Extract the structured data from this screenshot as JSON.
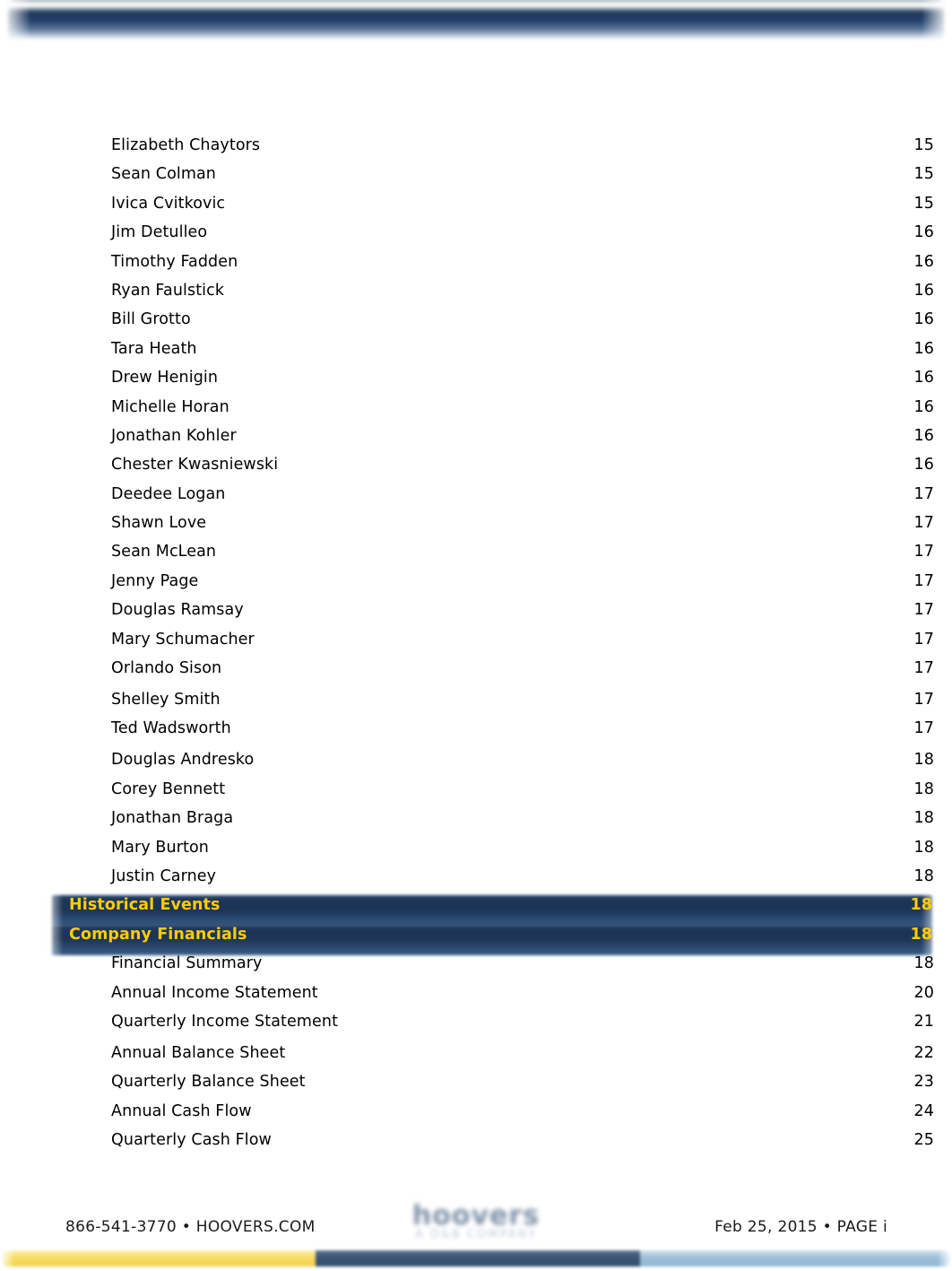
{
  "document": {
    "page_label": "i",
    "colors": {
      "navy": "#1d3557",
      "highlight_text": "#ffcc00",
      "body_text": "#000000",
      "bar_yellow": "#f6dc62",
      "bar_navy": "#32506e",
      "bar_lightblue": "#9dc0da"
    }
  },
  "toc": {
    "entries": [
      {
        "label": "Elizabeth Chaytors",
        "page": "15",
        "level": 2,
        "gap_before": false
      },
      {
        "label": "Sean Colman",
        "page": "15",
        "level": 2,
        "gap_before": false
      },
      {
        "label": "Ivica Cvitkovic",
        "page": "15",
        "level": 2,
        "gap_before": false
      },
      {
        "label": "Jim Detulleo",
        "page": "16",
        "level": 2,
        "gap_before": false
      },
      {
        "label": "Timothy Fadden",
        "page": "16",
        "level": 2,
        "gap_before": false
      },
      {
        "label": "Ryan Faulstick",
        "page": "16",
        "level": 2,
        "gap_before": false
      },
      {
        "label": "Bill Grotto",
        "page": "16",
        "level": 2,
        "gap_before": false
      },
      {
        "label": "Tara Heath",
        "page": "16",
        "level": 2,
        "gap_before": false
      },
      {
        "label": "Drew Henigin",
        "page": "16",
        "level": 2,
        "gap_before": false
      },
      {
        "label": "Michelle Horan",
        "page": "16",
        "level": 2,
        "gap_before": false
      },
      {
        "label": "Jonathan Kohler",
        "page": "16",
        "level": 2,
        "gap_before": false
      },
      {
        "label": "Chester Kwasniewski",
        "page": "16",
        "level": 2,
        "gap_before": false
      },
      {
        "label": "Deedee Logan",
        "page": "17",
        "level": 2,
        "gap_before": false
      },
      {
        "label": "Shawn Love",
        "page": "17",
        "level": 2,
        "gap_before": false
      },
      {
        "label": "Sean McLean",
        "page": "17",
        "level": 2,
        "gap_before": false
      },
      {
        "label": "Jenny Page",
        "page": "17",
        "level": 2,
        "gap_before": false
      },
      {
        "label": "Douglas Ramsay",
        "page": "17",
        "level": 2,
        "gap_before": false
      },
      {
        "label": "Mary Schumacher",
        "page": "17",
        "level": 2,
        "gap_before": false
      },
      {
        "label": "Orlando Sison",
        "page": "17",
        "level": 2,
        "gap_before": false
      },
      {
        "label": "Shelley Smith",
        "page": "17",
        "level": 2,
        "gap_before": true
      },
      {
        "label": "Ted Wadsworth",
        "page": "17",
        "level": 2,
        "gap_before": false
      },
      {
        "label": "Douglas Andresko",
        "page": "18",
        "level": 2,
        "gap_before": true
      },
      {
        "label": "Corey Bennett",
        "page": "18",
        "level": 2,
        "gap_before": false
      },
      {
        "label": "Jonathan Braga",
        "page": "18",
        "level": 2,
        "gap_before": false
      },
      {
        "label": "Mary Burton",
        "page": "18",
        "level": 2,
        "gap_before": false
      },
      {
        "label": "Justin Carney",
        "page": "18",
        "level": 2,
        "gap_before": false
      },
      {
        "label": "Historical Events",
        "page": "18",
        "level": 1,
        "gap_before": false
      },
      {
        "label": "Company Financials",
        "page": "18",
        "level": 1,
        "gap_before": false
      },
      {
        "label": "Financial Summary",
        "page": "18",
        "level": 2,
        "gap_before": false
      },
      {
        "label": "Annual Income Statement",
        "page": "20",
        "level": 2,
        "gap_before": false
      },
      {
        "label": "Quarterly Income Statement",
        "page": "21",
        "level": 2,
        "gap_before": false
      },
      {
        "label": "Annual Balance Sheet",
        "page": "22",
        "level": 2,
        "gap_before": true
      },
      {
        "label": "Quarterly Balance Sheet",
        "page": "23",
        "level": 2,
        "gap_before": false
      },
      {
        "label": "Annual Cash Flow",
        "page": "24",
        "level": 2,
        "gap_before": false
      },
      {
        "label": "Quarterly Cash Flow",
        "page": "25",
        "level": 2,
        "gap_before": false
      }
    ]
  },
  "footer": {
    "left": "866-541-3770 • HOOVERS.COM",
    "right": "Feb 25, 2015 • PAGE i",
    "logo_word": "hoovers",
    "logo_sub": "A D&B COMPANY"
  }
}
